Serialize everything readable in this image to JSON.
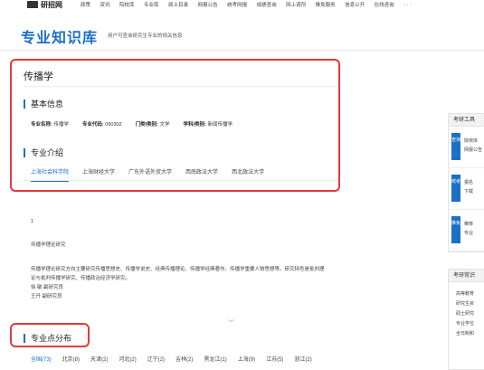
{
  "nav": {
    "logo": "研招网",
    "items": [
      "政策",
      "资讯",
      "院校库",
      "专业库",
      "硕士目录",
      "网报公告",
      "统考网报",
      "成绩查询",
      "网上调剂",
      "推免服务",
      "信息公开",
      "在线咨询"
    ],
    "more": "···"
  },
  "header": {
    "title": "专业知识库",
    "subtitle": "用户可查询研究生专业的相关信息"
  },
  "major": {
    "name": "传播学",
    "basic_title": "基本信息",
    "info": [
      {
        "label": "专业名称:",
        "value": "传播学"
      },
      {
        "label": "专业代码:",
        "value": "050302"
      },
      {
        "label": "门类/类别:",
        "value": "文学"
      },
      {
        "label": "学科/类别:",
        "value": "新闻传播学"
      }
    ],
    "intro_title": "专业介绍",
    "tabs": [
      "上海社会科学院",
      "上海财经大学",
      "广东外语外贸大学",
      "西南政法大学",
      "西北政法大学"
    ]
  },
  "content": {
    "index": "1",
    "direction": "传播学理论研究",
    "desc1": "传播学理论研究方向主要研究传播思想史、传播学说史、经典传播理论、传播学经典著作、传播学重要人物思想等。研究特色是批判理",
    "desc2": "论与批判传播学研究、传播政治经济学研究。",
    "people1": "徐 敏 副研究员",
    "people2": "王丹 副研究员"
  },
  "distribution": {
    "title": "专业点分布",
    "tabs": [
      "全国(73)",
      "北京(8)",
      "天津(2)",
      "河北(2)",
      "辽宁(2)",
      "吉林(2)",
      "黑龙江(1)",
      "上海(9)",
      "江苏(5)",
      "浙江(2)"
    ]
  },
  "sidebar": {
    "tools_title": "考研工具",
    "rows": [
      {
        "badge": "查询",
        "line1": "院校库",
        "line2": "网报公告"
      },
      {
        "badge": "统考",
        "line1": "报名",
        "line2": "下载"
      },
      {
        "badge": "推免",
        "line1": "推荐",
        "line2": "专业"
      }
    ],
    "faq_title": "考研常识",
    "faq": [
      "高等教育",
      "研究生资",
      "硕士研究",
      "专业学位",
      "全日制和"
    ]
  },
  "colors": {
    "accent": "#1b70c8",
    "highlight": "#e5383b"
  }
}
